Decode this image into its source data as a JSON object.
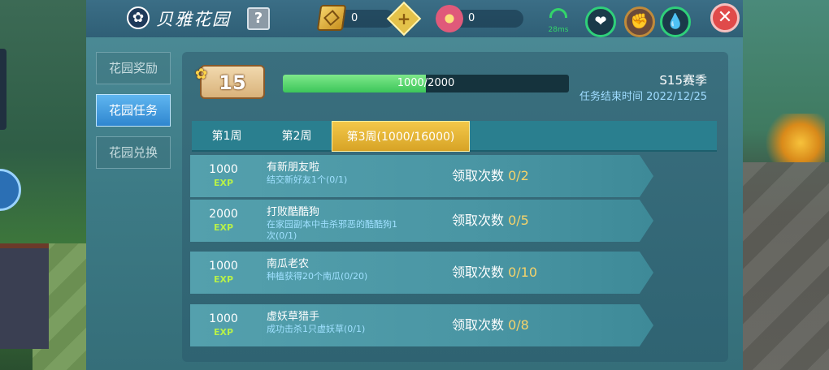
{
  "header": {
    "title": "贝雅花园",
    "help_label": "?",
    "gold_value": "0",
    "flower_value": "0",
    "plus_label": "+",
    "ping": "28ms",
    "close_label": "✕"
  },
  "sidebar": {
    "items": [
      {
        "label": "花园奖励"
      },
      {
        "label": "花园任务"
      },
      {
        "label": "花园兑换"
      }
    ]
  },
  "progress": {
    "level": "15",
    "text": "1000/2000",
    "value": 0.5,
    "season": "S15赛季",
    "end_time": "任务结束时间 2022/12/25"
  },
  "weeks": [
    {
      "label": "第1周"
    },
    {
      "label": "第2周"
    },
    {
      "label": "第3周(1000/16000)"
    }
  ],
  "tasks": [
    {
      "exp": "1000",
      "exp_label": "EXP",
      "name": "有新朋友啦",
      "desc": "结交新好友1个(0/1)",
      "claim_label": "领取次数",
      "claim_count": "0/2"
    },
    {
      "exp": "2000",
      "exp_label": "EXP",
      "name": "打败酷酷狗",
      "desc": "在家园副本中击杀邪恶的酷酷狗1次(0/1)",
      "claim_label": "领取次数",
      "claim_count": "0/5"
    },
    {
      "exp": "1000",
      "exp_label": "EXP",
      "name": "南瓜老农",
      "desc": "种植获得20个南瓜(0/20)",
      "claim_label": "领取次数",
      "claim_count": "0/10"
    },
    {
      "exp": "1000",
      "exp_label": "EXP",
      "name": "虚妖草猎手",
      "desc": "成功击杀1只虚妖草(0/1)",
      "claim_label": "领取次数",
      "claim_count": "0/8"
    }
  ],
  "colors": {
    "accent_gold": "#f6d36a",
    "exp_green": "#b6f04a",
    "active_tab_blue": "#2f86cf"
  }
}
